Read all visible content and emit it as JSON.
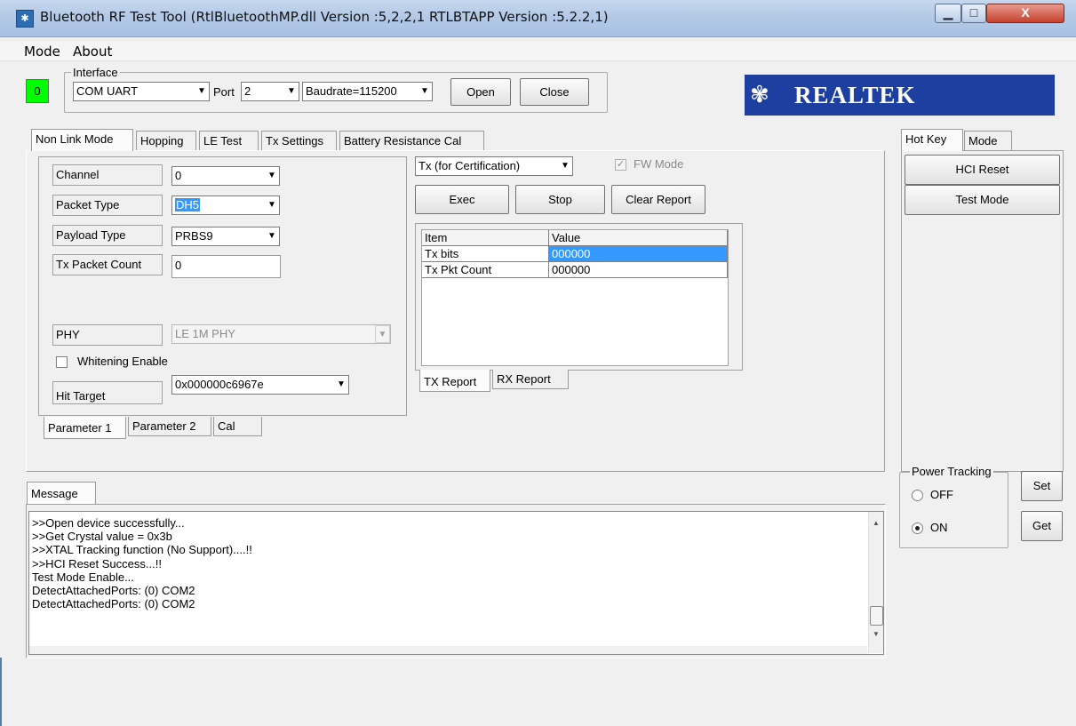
{
  "window": {
    "title": "Bluetooth RF Test Tool (RtlBluetoothMP.dll Version :5,2,2,1   RTLBTAPP Version :5.2.2,1)",
    "minimize_glyph": "▁",
    "maximize_glyph": "□",
    "close_glyph": "X"
  },
  "menu": {
    "items": [
      "Mode",
      "About"
    ]
  },
  "status": {
    "indicator": "0",
    "indicator_color": "#00ff00"
  },
  "interface": {
    "group_title": "Interface",
    "connection": "COM UART",
    "port_label": "Port",
    "port": "2",
    "baudrate": "Baudrate=115200",
    "open_label": "Open",
    "close_label": "Close"
  },
  "logo": {
    "text": "REALTEK",
    "bg_color": "#1c3fa0"
  },
  "main_tabs": [
    "Non Link Mode",
    "Hopping",
    "LE Test",
    "Tx Settings",
    "Battery Resistance Cal"
  ],
  "params": {
    "channel_label": "Channel",
    "channel": "0",
    "packet_type_label": "Packet Type",
    "packet_type": "DH5",
    "payload_type_label": "Payload Type",
    "payload_type": "PRBS9",
    "tx_packet_count_label": "Tx Packet Count",
    "tx_packet_count": "0",
    "phy_label": "PHY",
    "phy": "LE 1M PHY",
    "whitening_label": "Whitening Enable",
    "whitening_checked": false,
    "hit_target_label": "Hit Target",
    "hit_target": "0x000000c6967e"
  },
  "param_tabs": [
    "Parameter 1",
    "Parameter 2",
    "Cal"
  ],
  "test": {
    "mode": "Tx (for Certification)",
    "fw_mode_label": "FW Mode",
    "fw_mode_checked": true,
    "exec_label": "Exec",
    "stop_label": "Stop",
    "clear_label": "Clear Report"
  },
  "report": {
    "columns": [
      "Item",
      "Value"
    ],
    "rows": [
      {
        "item": "Tx bits",
        "value": "000000"
      },
      {
        "item": "Tx Pkt Count",
        "value": "000000"
      }
    ],
    "tabs": [
      "TX Report",
      "RX Report"
    ]
  },
  "hotkey": {
    "tabs": [
      "Hot Key",
      "Mode"
    ],
    "buttons": [
      "HCI Reset",
      "Test Mode"
    ]
  },
  "power_tracking": {
    "title": "Power Tracking",
    "options": [
      "OFF",
      "ON"
    ],
    "selected": "ON",
    "set_label": "Set",
    "get_label": "Get"
  },
  "message": {
    "tab": "Message",
    "lines": [
      ">>Open device successfully...",
      ">>Get Crystal value = 0x3b",
      ">>XTAL Tracking function (No Support)....!!",
      ">>HCI Reset Success...!!",
      "Test Mode Enable...",
      "DetectAttachedPorts: (0) COM2",
      "DetectAttachedPorts: (0) COM2"
    ]
  }
}
